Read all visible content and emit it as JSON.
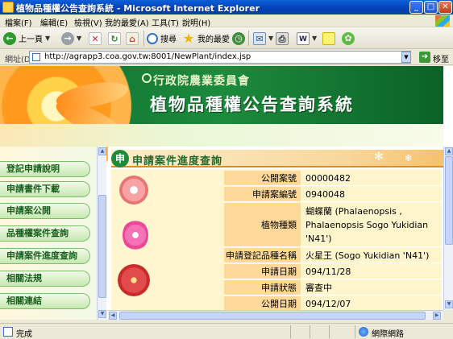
{
  "window": {
    "title": "植物品種權公告查詢系統 - Microsoft Internet Explorer",
    "buttons": {
      "minimize": "_",
      "maximize": "□",
      "close": "✕"
    }
  },
  "menu": [
    "檔案(F)",
    "編輯(E)",
    "檢視(V)",
    "我的最愛(A)",
    "工具(T)",
    "說明(H)"
  ],
  "toolbar": {
    "back": "上一頁",
    "search": "搜尋",
    "favorites": "我的最愛"
  },
  "address": {
    "label": "網址(D)",
    "url": "http://agrapp3.coa.gov.tw:8001/NewPlant/index.jsp",
    "go": "移至"
  },
  "banner": {
    "org": "行政院農業委員會",
    "title": "植物品種權公告查詢系統"
  },
  "nav": [
    "登記申請說明",
    "申請書件下載",
    "申請案公開",
    "品種權案件查詢",
    "申請案件進度查詢",
    "相關法規",
    "相關連結"
  ],
  "section": {
    "badge": "申",
    "title": "申請案件進度查詢"
  },
  "detail": {
    "rows": [
      {
        "label": "公開案號",
        "value": "00000482"
      },
      {
        "label": "申請案編號",
        "value": "0940048"
      },
      {
        "label": "植物種類",
        "value": "蝴蝶蘭 (Phalaenopsis , Phalaenopsis Sogo Yukidian 'N41')"
      },
      {
        "label": "申請登記品種名稱",
        "value": "火星王 (Sogo Yukidian 'N41')"
      },
      {
        "label": "申請日期",
        "value": "094/11/28"
      },
      {
        "label": "申請狀態",
        "value": "審查中"
      },
      {
        "label": "公開日期",
        "value": "094/12/07"
      }
    ]
  },
  "status": {
    "text": "完成",
    "zone": "網際網路"
  },
  "colors": {
    "titlebar": "#0441b7",
    "banner": "#1c8b3c",
    "accent": "#e38a1a",
    "label_bg": "#ffd99a",
    "value_bg": "#fff5cc"
  }
}
